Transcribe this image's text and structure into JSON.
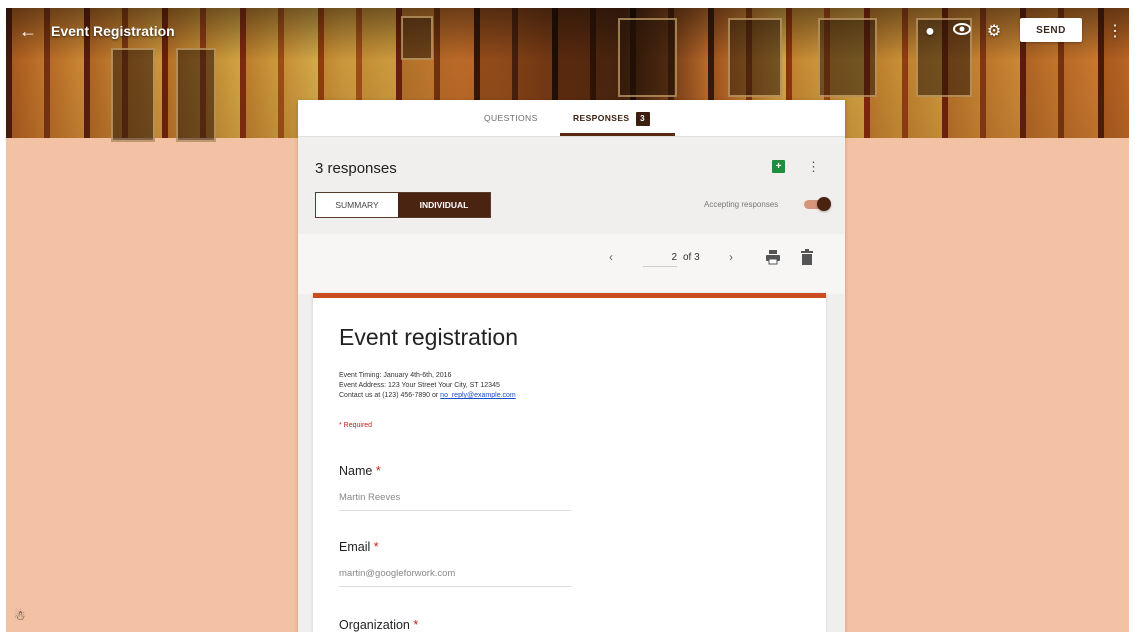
{
  "header": {
    "title": "Event Registration",
    "send_label": "SEND",
    "icons": [
      "back-arrow-icon",
      "palette-icon",
      "eye-icon",
      "gear-icon",
      "more-vert-icon"
    ]
  },
  "tabs": {
    "questions": "QUESTIONS",
    "responses": "RESPONSES",
    "responses_badge": "3"
  },
  "summary": {
    "count_text": "3 responses",
    "seg_summary": "SUMMARY",
    "seg_individual": "INDIVIDUAL",
    "accepting_label": "Accepting responses",
    "accepting_on": true
  },
  "pager": {
    "current": "2",
    "of_text": "of 3"
  },
  "form": {
    "title": "Event registration",
    "desc_line1": "Event Timing: January 4th-6th, 2016",
    "desc_line2": "Event Address: 123 Your Street Your City, ST 12345",
    "desc_line3_prefix": "Contact us at (123) 456-7890 or ",
    "contact_email": "no_reply@example.com",
    "required_note": "* Required",
    "questions": [
      {
        "label": "Name",
        "required": "*",
        "answer": "Martin Reeves"
      },
      {
        "label": "Email",
        "required": "*",
        "answer": "martin@googleforwork.com"
      },
      {
        "label": "Organization",
        "required": "*"
      }
    ]
  },
  "colors": {
    "page_bg": "#f3c1a3",
    "accent": "#4a2311",
    "form_bar": "#c94d1e",
    "required_red": "#c5221f"
  }
}
